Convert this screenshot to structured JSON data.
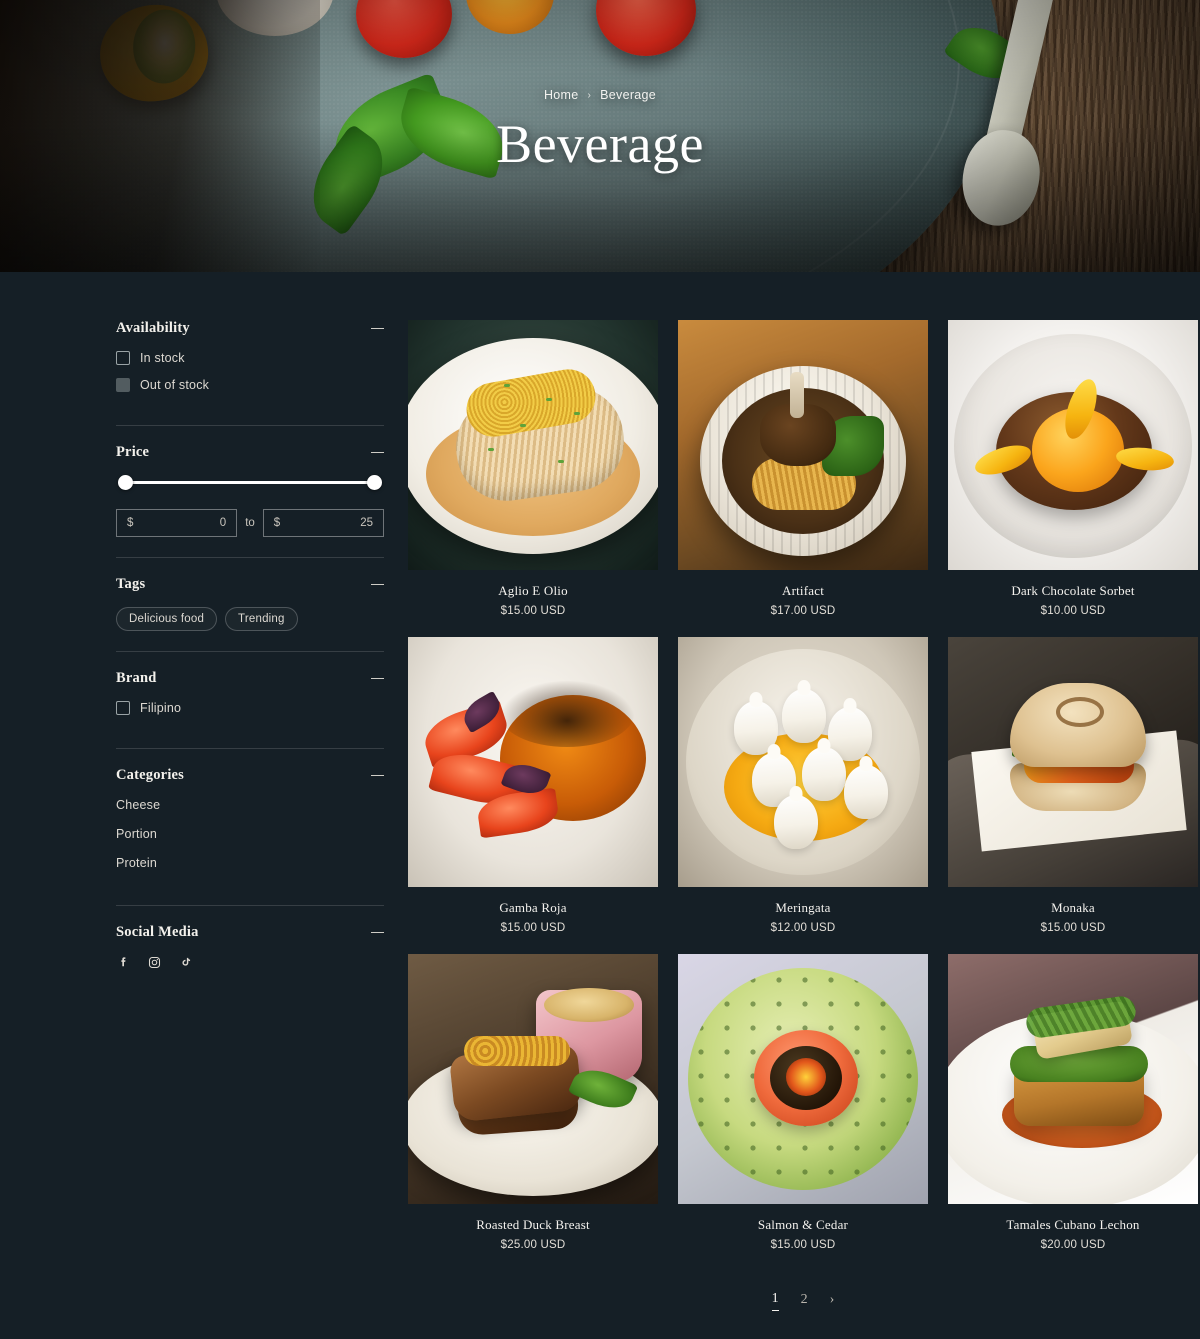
{
  "hero": {
    "breadcrumb": {
      "home": "Home",
      "separator": "›",
      "current": "Beverage"
    },
    "title": "Beverage"
  },
  "theme": {
    "background": "#151f26",
    "text_primary": "#f4f2ee",
    "text_secondary": "#ddd9d2",
    "divider": "rgba(255,255,255,.14)"
  },
  "sidebar": {
    "facets": [
      {
        "title": "Availability",
        "collapse_icon": "minus-icon",
        "options": [
          {
            "label": "In stock",
            "checked": false,
            "disabled": false
          },
          {
            "label": "Out of stock",
            "checked": false,
            "disabled": true
          }
        ]
      },
      {
        "title": "Price",
        "collapse_icon": "minus-icon",
        "currency": "$",
        "separator": "to",
        "min_value": "0",
        "max_value": "25",
        "slider": {
          "low_percent": 0,
          "high_percent": 100
        }
      },
      {
        "title": "Tags",
        "collapse_icon": "minus-icon",
        "tags": [
          "Delicious food",
          "Trending"
        ]
      },
      {
        "title": "Brand",
        "collapse_icon": "minus-icon",
        "options": [
          {
            "label": "Filipino",
            "checked": false
          }
        ]
      },
      {
        "title": "Categories",
        "collapse_icon": "minus-icon",
        "items": [
          "Cheese",
          "Portion",
          "Protein"
        ]
      },
      {
        "title": "Social Media",
        "collapse_icon": "minus-icon",
        "socials": [
          "facebook-icon",
          "instagram-icon",
          "tiktok-icon"
        ]
      }
    ]
  },
  "products": [
    {
      "name": "Aglio E Olio",
      "price": "$15.00 USD",
      "image": "pasta-in-cream-sauce-photo"
    },
    {
      "name": "Artifact",
      "price": "$17.00 USD",
      "image": "braised-short-rib-noodle-bowl-photo"
    },
    {
      "name": "Dark Chocolate Sorbet",
      "price": "$10.00 USD",
      "image": "chocolate-dome-with-orange-sphere-photo"
    },
    {
      "name": "Gamba Roja",
      "price": "$15.00 USD",
      "image": "red-prawns-with-orange-sauce-photo"
    },
    {
      "name": "Meringata",
      "price": "$12.00 USD",
      "image": "meringue-peaks-with-mango-photo"
    },
    {
      "name": "Monaka",
      "price": "$15.00 USD",
      "image": "stuffed-bun-sandwich-photo"
    },
    {
      "name": "Roasted Duck Breast",
      "price": "$25.00 USD",
      "image": "duck-breast-with-side-pot-photo"
    },
    {
      "name": "Salmon & Cedar",
      "price": "$15.00 USD",
      "image": "salmon-with-green-herb-sauce-photo"
    },
    {
      "name": "Tamales Cubano Lechon",
      "price": "$20.00 USD",
      "image": "tamale-with-herb-topping-photo"
    }
  ],
  "pagination": {
    "pages": [
      "1",
      "2"
    ],
    "current": "1",
    "next_icon": "chevron-right-icon",
    "next_glyph": "›"
  }
}
